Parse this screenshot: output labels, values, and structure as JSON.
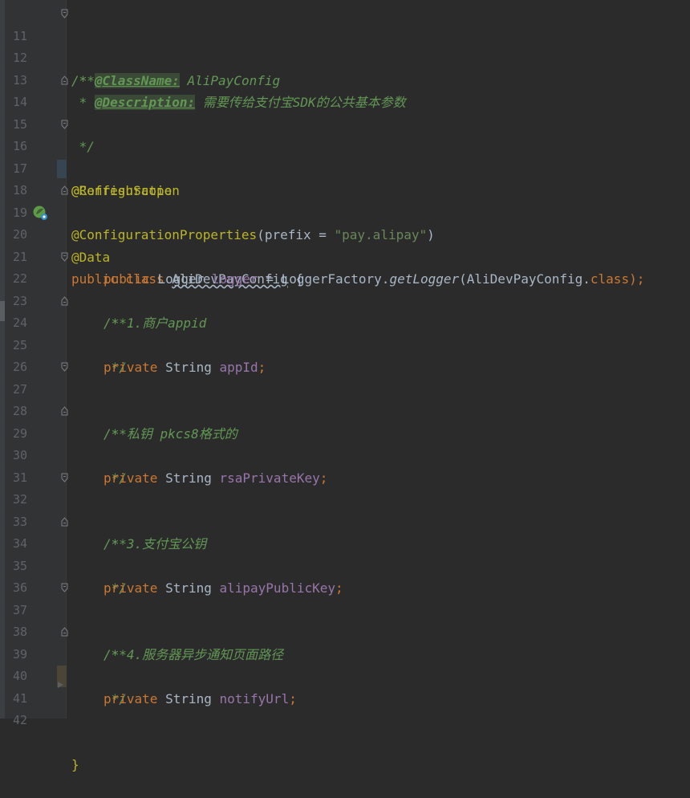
{
  "lines": [
    {
      "n": "11"
    },
    {
      "n": "12"
    },
    {
      "n": "13"
    },
    {
      "n": "14"
    },
    {
      "n": "15"
    },
    {
      "n": "16"
    },
    {
      "n": "17"
    },
    {
      "n": "18"
    },
    {
      "n": "19"
    },
    {
      "n": "20"
    },
    {
      "n": "21"
    },
    {
      "n": "22"
    },
    {
      "n": "23"
    },
    {
      "n": "24"
    },
    {
      "n": "25"
    },
    {
      "n": "26"
    },
    {
      "n": "27"
    },
    {
      "n": "28"
    },
    {
      "n": "29"
    },
    {
      "n": "30"
    },
    {
      "n": "31"
    },
    {
      "n": "32"
    },
    {
      "n": "33"
    },
    {
      "n": "34"
    },
    {
      "n": "35"
    },
    {
      "n": "36"
    },
    {
      "n": "37"
    },
    {
      "n": "38"
    },
    {
      "n": "39"
    },
    {
      "n": "40"
    },
    {
      "n": "41"
    },
    {
      "n": "42"
    }
  ],
  "code": {
    "l11": "/**",
    "l12_star": " * ",
    "l12_tag": "@ClassName:",
    "l12_text": " AliPayConfig",
    "l13_star": " * ",
    "l13_tag": "@Description:",
    "l13_text": " 需要传给支付宝SDK的公共基本参数",
    "l14": " */",
    "l16": "@Configuration",
    "l17": "@RefreshScope",
    "l18_ann": "@ConfigurationProperties",
    "l18_open": "(prefix = ",
    "l18_str": "\"pay.alipay\"",
    "l18_close": ")",
    "l19": "@Data",
    "l20_kw": "public class ",
    "l20_cls": "AliDevPayConfig",
    "l20_rest": " {",
    "l21_kw": "public ",
    "l21_type": "Logger ",
    "l21_field": "logger",
    "l21_eq": " = LoggerFactory.",
    "l21_meth": "getLogger",
    "l21_arg": "(AliDevPayConfig.",
    "l21_classkw": "class",
    "l21_end": ");",
    "l22": "/**",
    "l23": " * 1.商户appid",
    "l24": " */",
    "l25_kw": "private ",
    "l25_type": "String ",
    "l25_field": "appId",
    "l25_end": ";",
    "l27": "/**",
    "l28": " * 私钥 pkcs8格式的",
    "l29": " */",
    "l30_kw": "private ",
    "l30_type": "String ",
    "l30_field": "rsaPrivateKey",
    "l30_end": ";",
    "l32": "/**",
    "l33": " * 3.支付宝公钥",
    "l34": " */",
    "l35_kw": "private ",
    "l35_type": "String ",
    "l35_field": "alipayPublicKey",
    "l35_end": ";",
    "l37": "/**",
    "l38": " * 4.服务器异步通知页面路径",
    "l39": " */",
    "l40_kw": "private ",
    "l40_type": "String ",
    "l40_field": "notifyUrl",
    "l40_end": ";",
    "l42": "}"
  }
}
